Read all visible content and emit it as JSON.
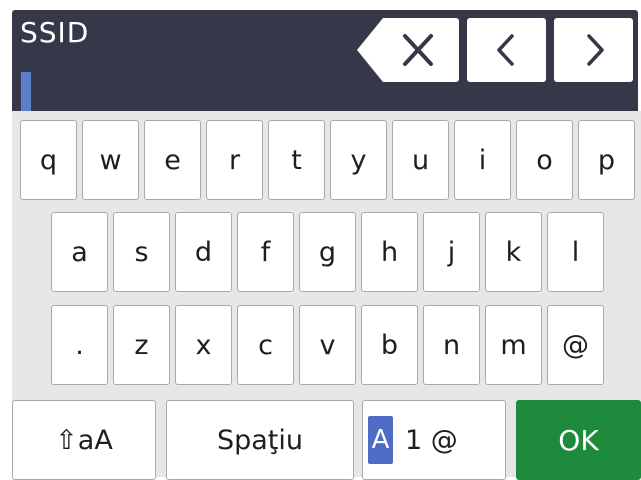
{
  "input": {
    "label": "SSID",
    "value": ""
  },
  "header_buttons": {
    "delete_icon": "backspace-icon",
    "left_icon": "chevron-left-icon",
    "right_icon": "chevron-right-icon"
  },
  "keyboard": {
    "row1": [
      "q",
      "w",
      "e",
      "r",
      "t",
      "y",
      "u",
      "i",
      "o",
      "p"
    ],
    "row2": [
      "a",
      "s",
      "d",
      "f",
      "g",
      "h",
      "j",
      "k",
      "l"
    ],
    "row3": [
      ".",
      "z",
      "x",
      "c",
      "v",
      "b",
      "n",
      "m",
      "@"
    ],
    "shift_label": "⇧aA",
    "space_label": "Spaţiu",
    "mode_active": "A",
    "mode_rest": "1 @",
    "ok_label": "OK"
  },
  "colors": {
    "panel": "#36384a",
    "cursor": "#5b7fc8",
    "ok": "#1e8a3b",
    "mode_highlight": "#4e6cc4"
  }
}
